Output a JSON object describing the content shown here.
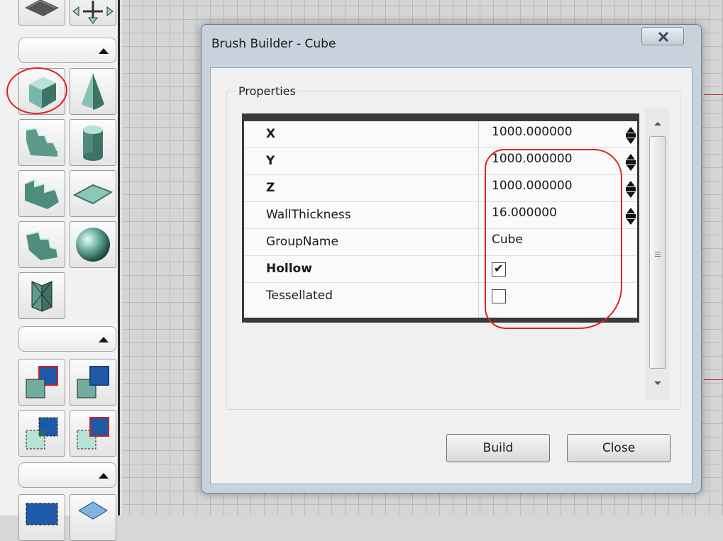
{
  "dialog": {
    "title": "Brush Builder - Cube",
    "group_label": "Properties",
    "properties": [
      {
        "name": "X",
        "value": "1000.000000",
        "bold": true
      },
      {
        "name": "Y",
        "value": "1000.000000",
        "bold": true
      },
      {
        "name": "Z",
        "value": "1000.000000",
        "bold": true
      },
      {
        "name": "WallThickness",
        "value": "16.000000",
        "bold": false
      },
      {
        "name": "GroupName",
        "value": "Cube",
        "bold": false
      },
      {
        "name": "Hollow",
        "checked": true,
        "bold": true
      },
      {
        "name": "Tessellated",
        "checked": false,
        "bold": false
      }
    ],
    "build_label": "Build",
    "close_label": "Close",
    "checkmark": "✔"
  },
  "toolbar": {
    "icons": [
      "sheet-brush-icon",
      "move-widget-icon",
      "cube-brush-icon",
      "cone-brush-icon",
      "curved-stair-icon",
      "cylinder-brush-icon",
      "linear-stair-icon",
      "plane-brush-icon",
      "spiral-stair-icon",
      "sphere-brush-icon",
      "volumetric-brush-icon",
      "csg-add-icon",
      "csg-subtract-icon",
      "csg-intersect-icon",
      "csg-deintersect-icon",
      "select-icon",
      "volume-icon"
    ]
  },
  "colors": {
    "annotation": "#e02020",
    "titlebar": "#c7d2dd"
  }
}
